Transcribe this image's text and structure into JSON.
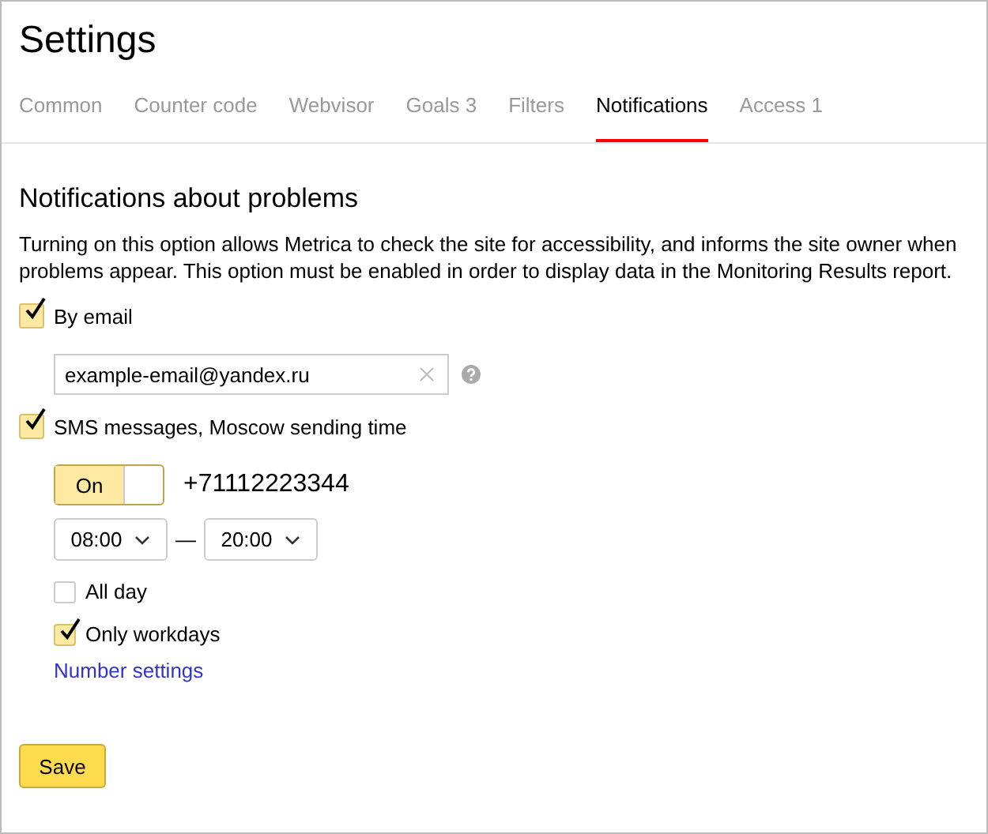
{
  "title": "Settings",
  "tabs": [
    {
      "label": "Common",
      "selected": false
    },
    {
      "label": "Counter code",
      "selected": false
    },
    {
      "label": "Webvisor",
      "selected": false
    },
    {
      "label": "Goals 3",
      "selected": false
    },
    {
      "label": "Filters",
      "selected": false
    },
    {
      "label": "Notifications",
      "selected": true
    },
    {
      "label": "Access 1",
      "selected": false
    }
  ],
  "section": {
    "heading": "Notifications about problems",
    "description": "Turning on this option allows Metrica to check the site for accessibility, and informs the site owner when problems appear. This option must be enabled in order to display data in the Monitoring Results report."
  },
  "email": {
    "label": "By email",
    "checked": true,
    "value": "example-email@yandex.ru"
  },
  "sms": {
    "label": "SMS messages, Moscow sending time",
    "checked": true,
    "toggle": {
      "label": "On",
      "on": true
    },
    "phone": "+71112223344",
    "from": "08:00",
    "separator": "—",
    "to": "20:00",
    "options": [
      {
        "label": "All day",
        "checked": false
      },
      {
        "label": "Only workdays",
        "checked": true
      }
    ],
    "link": "Number settings"
  },
  "save": "Save"
}
